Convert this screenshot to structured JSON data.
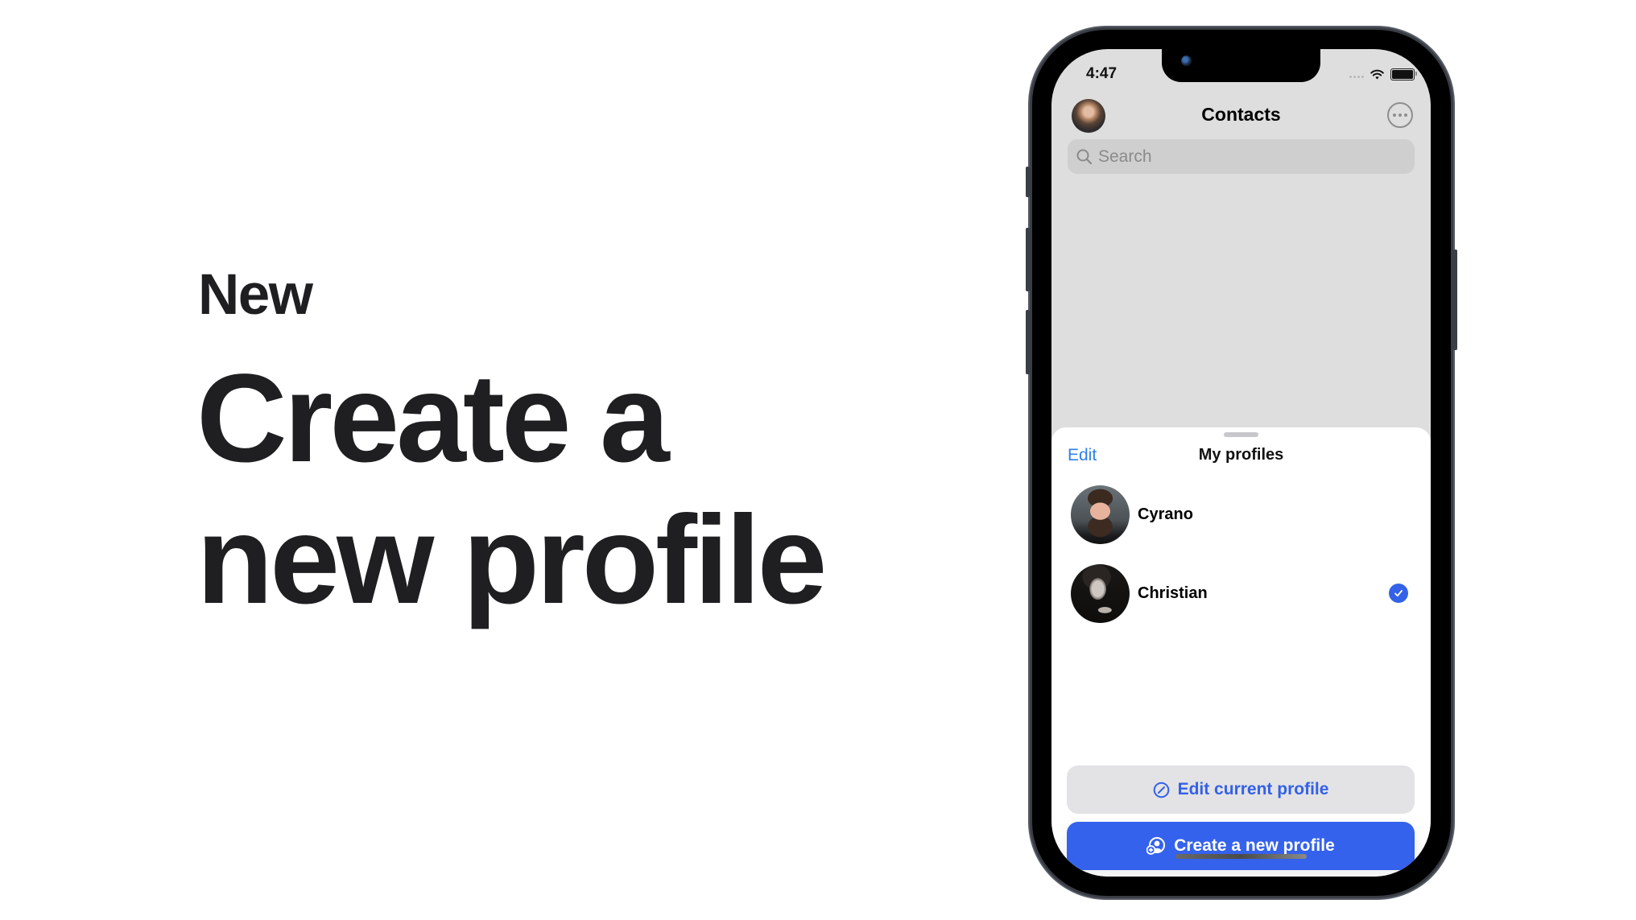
{
  "hero": {
    "kicker": "New",
    "title_line1": "Create a",
    "title_line2": "new profile"
  },
  "status_bar": {
    "time": "4:47",
    "icons": [
      "cellular-signal-icon",
      "wifi-icon",
      "battery-icon"
    ]
  },
  "nav": {
    "title": "Contacts",
    "avatar_icon": "user-avatar",
    "more_icon": "more-options-icon"
  },
  "search": {
    "placeholder": "Search",
    "icon": "search-icon"
  },
  "sheet": {
    "edit_label": "Edit",
    "title": "My profiles",
    "profiles": [
      {
        "name": "Cyrano",
        "selected": false
      },
      {
        "name": "Christian",
        "selected": true
      }
    ],
    "edit_current_label": "Edit current profile",
    "create_new_label": "Create a new profile"
  },
  "colors": {
    "accent": "#3462EC",
    "link": "#2F80EA",
    "screen_bg": "#DEDEDE",
    "text": "#1F1F21"
  }
}
